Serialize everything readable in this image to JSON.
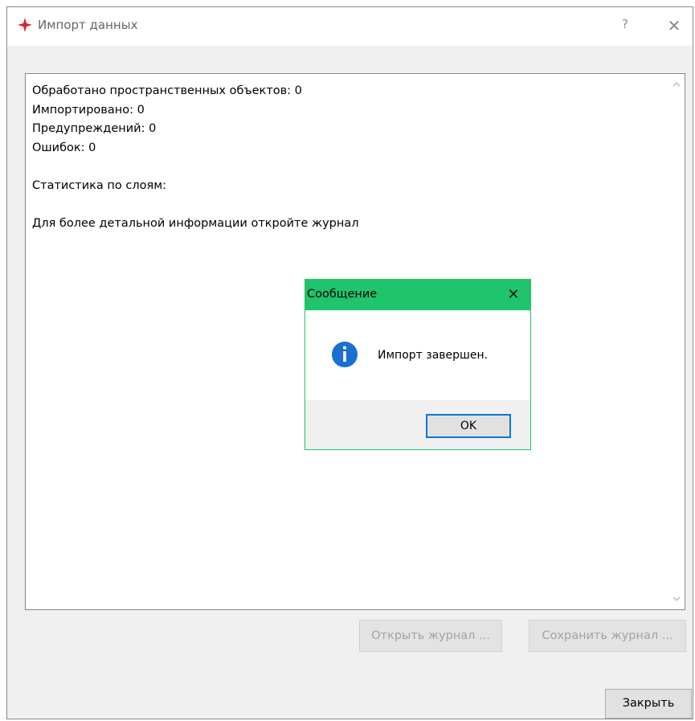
{
  "window": {
    "title": "Импорт данных",
    "help_label": "?",
    "close_label": "✕"
  },
  "log": {
    "text": "Обработано пространственных объектов: 0\nИмпортировано: 0\nПредупреждений: 0\nОшибок: 0\n\nСтатистика по слоям:\n\nДля более детальной информации откройте журнал"
  },
  "buttons": {
    "open_log": "Открыть журнал ...",
    "save_log": "Сохранить журнал ...",
    "close": "Закрыть"
  },
  "message_box": {
    "title": "Сообщение",
    "close_label": "✕",
    "text": "Импорт завершен.",
    "ok_label": "OK",
    "accent_color": "#1fc46c"
  },
  "icons": {
    "app": "red-star-icon",
    "info": "info-icon",
    "scroll_up": "chevron-up-icon",
    "scroll_down": "chevron-down-icon"
  }
}
